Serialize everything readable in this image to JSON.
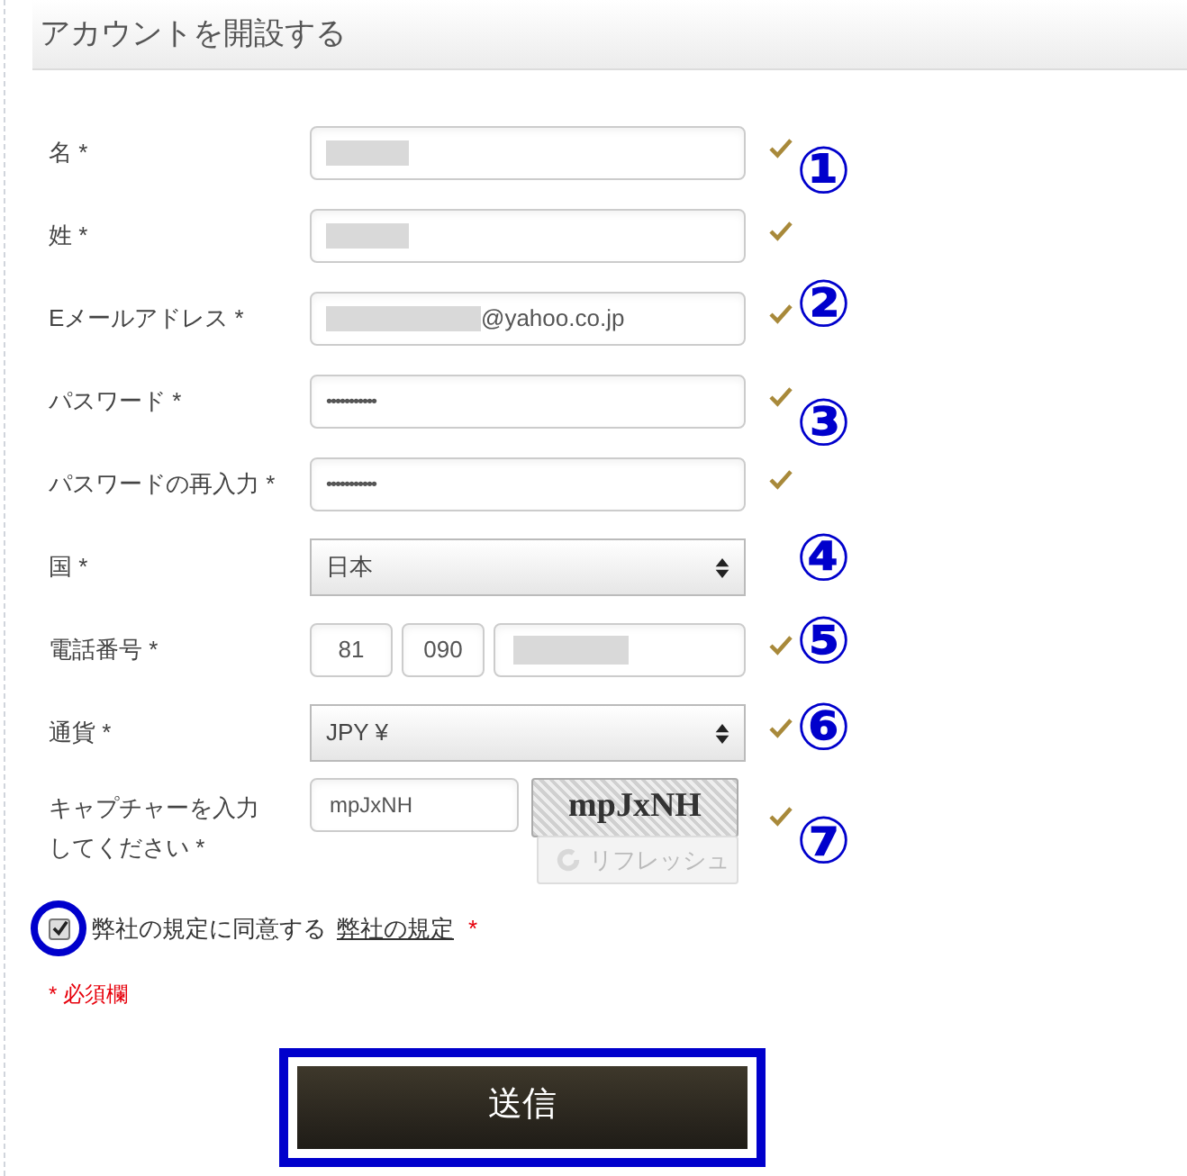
{
  "title": "アカウントを開設する",
  "fields": [
    {
      "kind": "text",
      "label": "名 *",
      "redacted": true,
      "valid": true
    },
    {
      "kind": "text",
      "label": "姓 *",
      "redacted": true,
      "valid": true
    },
    {
      "kind": "text",
      "label": "Eメールアドレス *",
      "redacted": true,
      "value": "@yahoo.co.jp",
      "valid": true
    },
    {
      "kind": "password",
      "label": "パスワード *",
      "value": "•••••••••••",
      "valid": true
    },
    {
      "kind": "password",
      "label": "パスワードの再入力 *",
      "value": "•••••••••••",
      "valid": true
    },
    {
      "kind": "select",
      "label": "国 *",
      "value": "日本",
      "valid": false
    },
    {
      "kind": "phone",
      "label": "電話番号 *",
      "parts": [
        "81",
        "090"
      ],
      "redacted": true,
      "valid": true
    },
    {
      "kind": "select",
      "label": "通貨 *",
      "value": "JPY ¥",
      "valid": true
    },
    {
      "kind": "captcha",
      "label": "キャプチャーを入力してください *",
      "value": "mpJxNH",
      "captcha_text": "mpJxNH",
      "refresh": "リフレッシュ",
      "valid": true
    }
  ],
  "terms": {
    "checked": true,
    "text": "弊社の規定に同意する",
    "link": "弊社の規定",
    "mark": "*"
  },
  "required_note": "* 必須欄",
  "submit": "送信",
  "annotations": [
    "①",
    "②",
    "③",
    "④",
    "⑤",
    "⑥",
    "⑦"
  ]
}
